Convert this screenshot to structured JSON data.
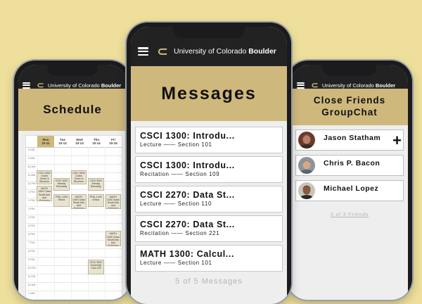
{
  "brand": {
    "name": "University of Colorado",
    "name_bold": "Boulder"
  },
  "schedule": {
    "title": "Schedule",
    "back": "<",
    "days": [
      {
        "name": "Mon",
        "date": "10-11",
        "today": true
      },
      {
        "name": "Tue",
        "date": "10-12",
        "today": false
      },
      {
        "name": "Wed",
        "date": "10-13",
        "today": false
      },
      {
        "name": "Thu",
        "date": "10-14",
        "today": false
      },
      {
        "name": "Fri",
        "date": "10-15",
        "today": false
      }
    ],
    "hours": [
      "8 AM",
      "9 AM",
      "10 AM",
      "11 AM",
      "12 PM",
      "1 PM",
      "2 PM",
      "3 PM",
      "4 PM",
      "5 PM",
      "6 PM",
      "7 PM",
      "8 PM",
      "9 PM",
      "10 PM",
      "11 PM",
      "12 AM",
      "1 AM",
      "2 AM",
      "3 AM"
    ],
    "events": [
      {
        "text": "CSCI 3002 Crash Chem & Biochem",
        "day": 0,
        "start": 3,
        "span": 1.1
      },
      {
        "text": "CSCI 3002 Weekly Remotely",
        "day": 1,
        "start": 4,
        "span": 1.0
      },
      {
        "text": "CSCI 3002 Crash Chem & Biochem",
        "day": 2,
        "start": 3,
        "span": 1.1
      },
      {
        "text": "CSCI 3002 Weekly Remotely",
        "day": 3,
        "start": 4,
        "span": 1.0
      },
      {
        "text": "MATH 1300 Class Small Arts and Sciences",
        "day": 0,
        "start": 5,
        "span": 1.2
      },
      {
        "text": "PHIL 1440 Ethics",
        "day": 1,
        "start": 6,
        "span": 1.0
      },
      {
        "text": "MATH 1300 Class Small Arts and Sciences",
        "day": 2,
        "start": 6,
        "span": 1.2
      },
      {
        "text": "PHIL 1440 Ethics",
        "day": 3,
        "start": 6,
        "span": 1.0
      },
      {
        "text": "MATH 1300 Class Small Arts and Sciences",
        "day": 4,
        "start": 6,
        "span": 1.2
      },
      {
        "text": "MATH 1300 Class Small Arts and Sciences",
        "day": 4,
        "start": 10.7,
        "span": 1.2
      },
      {
        "text": "CSCI 3002 University Club 100",
        "day": 3,
        "start": 14.3,
        "span": 1.2
      }
    ]
  },
  "messages": {
    "title": "Messages",
    "back": "<",
    "items": [
      {
        "title": "CSCI 1300: Introdu...",
        "sub": "Lecture —— Section 101"
      },
      {
        "title": "CSCI 1300: Introdu...",
        "sub": "Recitation —— Section 109"
      },
      {
        "title": "CSCI 2270: Data St...",
        "sub": "Lecture —— Section 110"
      },
      {
        "title": "CSCI 2270: Data St...",
        "sub": "Recitation —— Section 221"
      },
      {
        "title": "MATH 1300: Calcul...",
        "sub": "Lecture —— Section 101"
      }
    ],
    "count": "5 of 5 Messages"
  },
  "groupchat": {
    "title": "Close Friends GroupChat",
    "back": "<",
    "friends": [
      {
        "name": "Jason Statham",
        "skin": "#b7806a",
        "hair": "#5a3a2b",
        "shirt": "#3a2a26",
        "bg": "#6c3a2c"
      },
      {
        "name": "Chris P. Bacon",
        "skin": "#d2a88b",
        "hair": "#5b4638",
        "shirt": "#5b6570",
        "bg": "#8d949c"
      },
      {
        "name": "Michael Lopez",
        "skin": "#8a5a3e",
        "hair": "#1f1712",
        "shirt": "#2a2a2a",
        "bg": "#c9c4bb"
      }
    ],
    "count": "3 of 3 Friends",
    "add_label": "+"
  },
  "colors": {
    "background": "#eedf9c",
    "gold": "#cfb87c",
    "appbar": "#222222",
    "card_border": "#c9c9c9"
  }
}
